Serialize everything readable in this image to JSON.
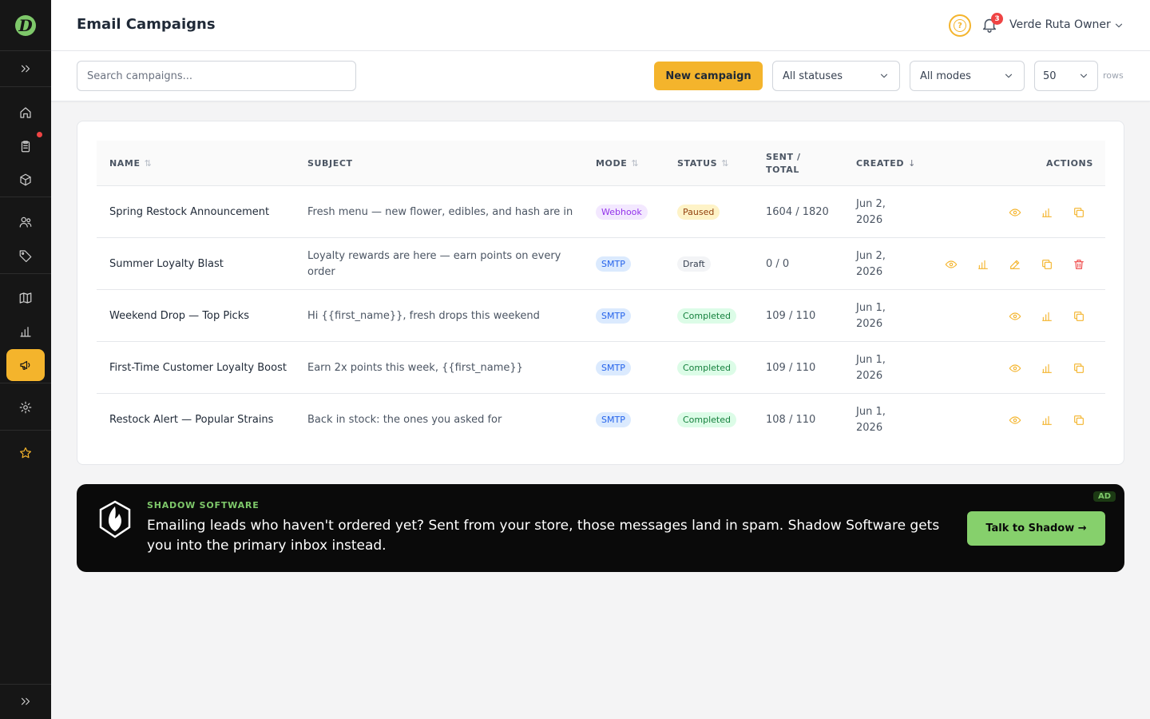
{
  "app": {
    "logo_letter": "D",
    "page_title": "Email Campaigns",
    "user_name": "Verde Ruta Owner",
    "notification_count": "3",
    "help_symbol": "?",
    "accent_color": "#f4b42c",
    "brand_color": "#7ec86a"
  },
  "sidebar": {
    "items": [
      {
        "icon": "chevrons-right-icon"
      },
      {
        "icon": "home-icon"
      },
      {
        "icon": "clipboard-icon"
      },
      {
        "icon": "box-icon"
      },
      {
        "icon": "users-icon"
      },
      {
        "icon": "tag-icon"
      },
      {
        "icon": "map-icon"
      },
      {
        "icon": "bar-chart-icon"
      },
      {
        "icon": "megaphone-icon",
        "active": true
      },
      {
        "icon": "gear-icon"
      },
      {
        "icon": "star-icon"
      },
      {
        "icon": "chevrons-right-icon"
      }
    ]
  },
  "toolbar": {
    "search_placeholder": "Search campaigns...",
    "new_button": "New campaign",
    "status_filter": "All statuses",
    "mode_filter": "All modes",
    "rows_value": "50",
    "rows_label": "rows"
  },
  "table": {
    "headers": {
      "name": "NAME",
      "subject": "SUBJECT",
      "mode": "MODE",
      "status": "STATUS",
      "sent_line1": "SENT /",
      "sent_line2": "TOTAL",
      "created": "CREATED",
      "actions": "ACTIONS"
    },
    "rows": [
      {
        "name": "Spring Restock Announcement",
        "subject": "Fresh menu — new flower, edibles, and hash are in",
        "mode": "Webhook",
        "status": "Paused",
        "sent": "1604 / 1820",
        "created": "Jun 2, 2026"
      },
      {
        "name": "Summer Loyalty Blast",
        "subject": "Loyalty rewards are here — earn points on every order",
        "mode": "SMTP",
        "status": "Draft",
        "sent": "0 / 0",
        "created": "Jun 2, 2026"
      },
      {
        "name": "Weekend Drop — Top Picks",
        "subject": "Hi {{first_name}}, fresh drops this weekend",
        "mode": "SMTP",
        "status": "Completed",
        "sent": "109 / 110",
        "created": "Jun 1, 2026"
      },
      {
        "name": "First-Time Customer Loyalty Boost",
        "subject": "Earn 2x points this week, {{first_name}}",
        "mode": "SMTP",
        "status": "Completed",
        "sent": "109 / 110",
        "created": "Jun 1, 2026"
      },
      {
        "name": "Restock Alert — Popular Strains",
        "subject": "Back in stock: the ones you asked for",
        "mode": "SMTP",
        "status": "Completed",
        "sent": "108 / 110",
        "created": "Jun 1, 2026"
      }
    ]
  },
  "ad": {
    "brand": "SHADOW SOFTWARE",
    "text": "Emailing leads who haven't ordered yet? Sent from your store, those messages land in spam. Shadow Software gets you into the primary inbox instead.",
    "cta": "Talk to Shadow →",
    "tag": "AD"
  }
}
